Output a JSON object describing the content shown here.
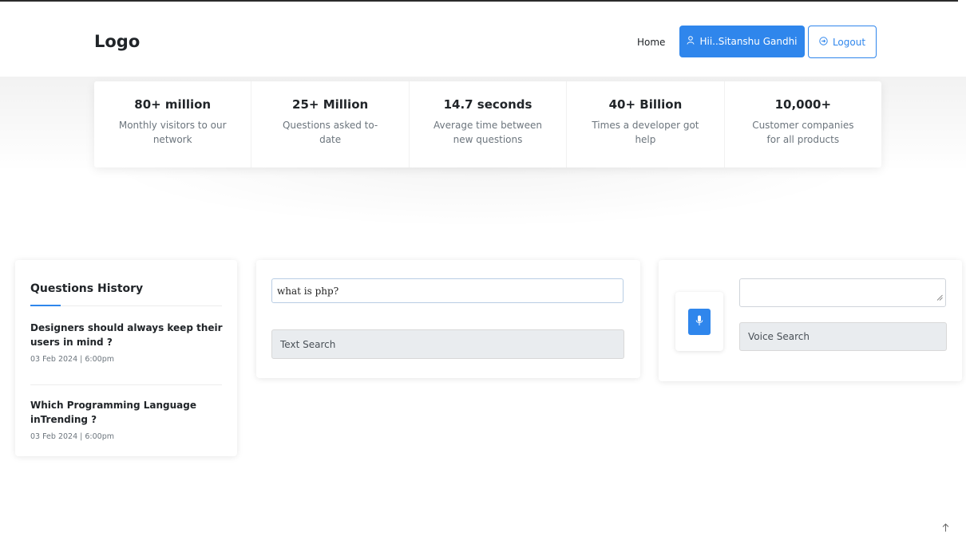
{
  "header": {
    "logo": "Logo",
    "nav_home": "Home",
    "user_button": "Hii..Sitanshu Gandhi",
    "logout_button": "Logout"
  },
  "stats": [
    {
      "value": "80+ million",
      "label": "Monthly visitors to our network"
    },
    {
      "value": "25+ Million",
      "label": "Questions asked to-date"
    },
    {
      "value": "14.7 seconds",
      "label": "Average time between new questions"
    },
    {
      "value": "40+ Billion",
      "label": "Times a developer got help"
    },
    {
      "value": "10,000+",
      "label": "Customer companies for all products"
    }
  ],
  "history": {
    "title": "Questions History",
    "items": [
      {
        "question": "Designers should always keep their users in mind ?",
        "date": "03 Feb 2024 | 6:00pm"
      },
      {
        "question": "Which Programming Language inTrending ?",
        "date": "03 Feb 2024 | 6:00pm"
      }
    ]
  },
  "text_search": {
    "input_value": "what is php?",
    "button_label": "Text Search"
  },
  "voice_search": {
    "textarea_value": "",
    "button_label": "Voice Search"
  },
  "icons": {
    "user": "user-icon",
    "logout": "logout-icon",
    "mic": "microphone-icon",
    "scroll_top": "arrow-up-icon"
  },
  "colors": {
    "accent": "#2f86ec",
    "button_gray": "#e9ecef",
    "muted_text": "#6c757d"
  }
}
